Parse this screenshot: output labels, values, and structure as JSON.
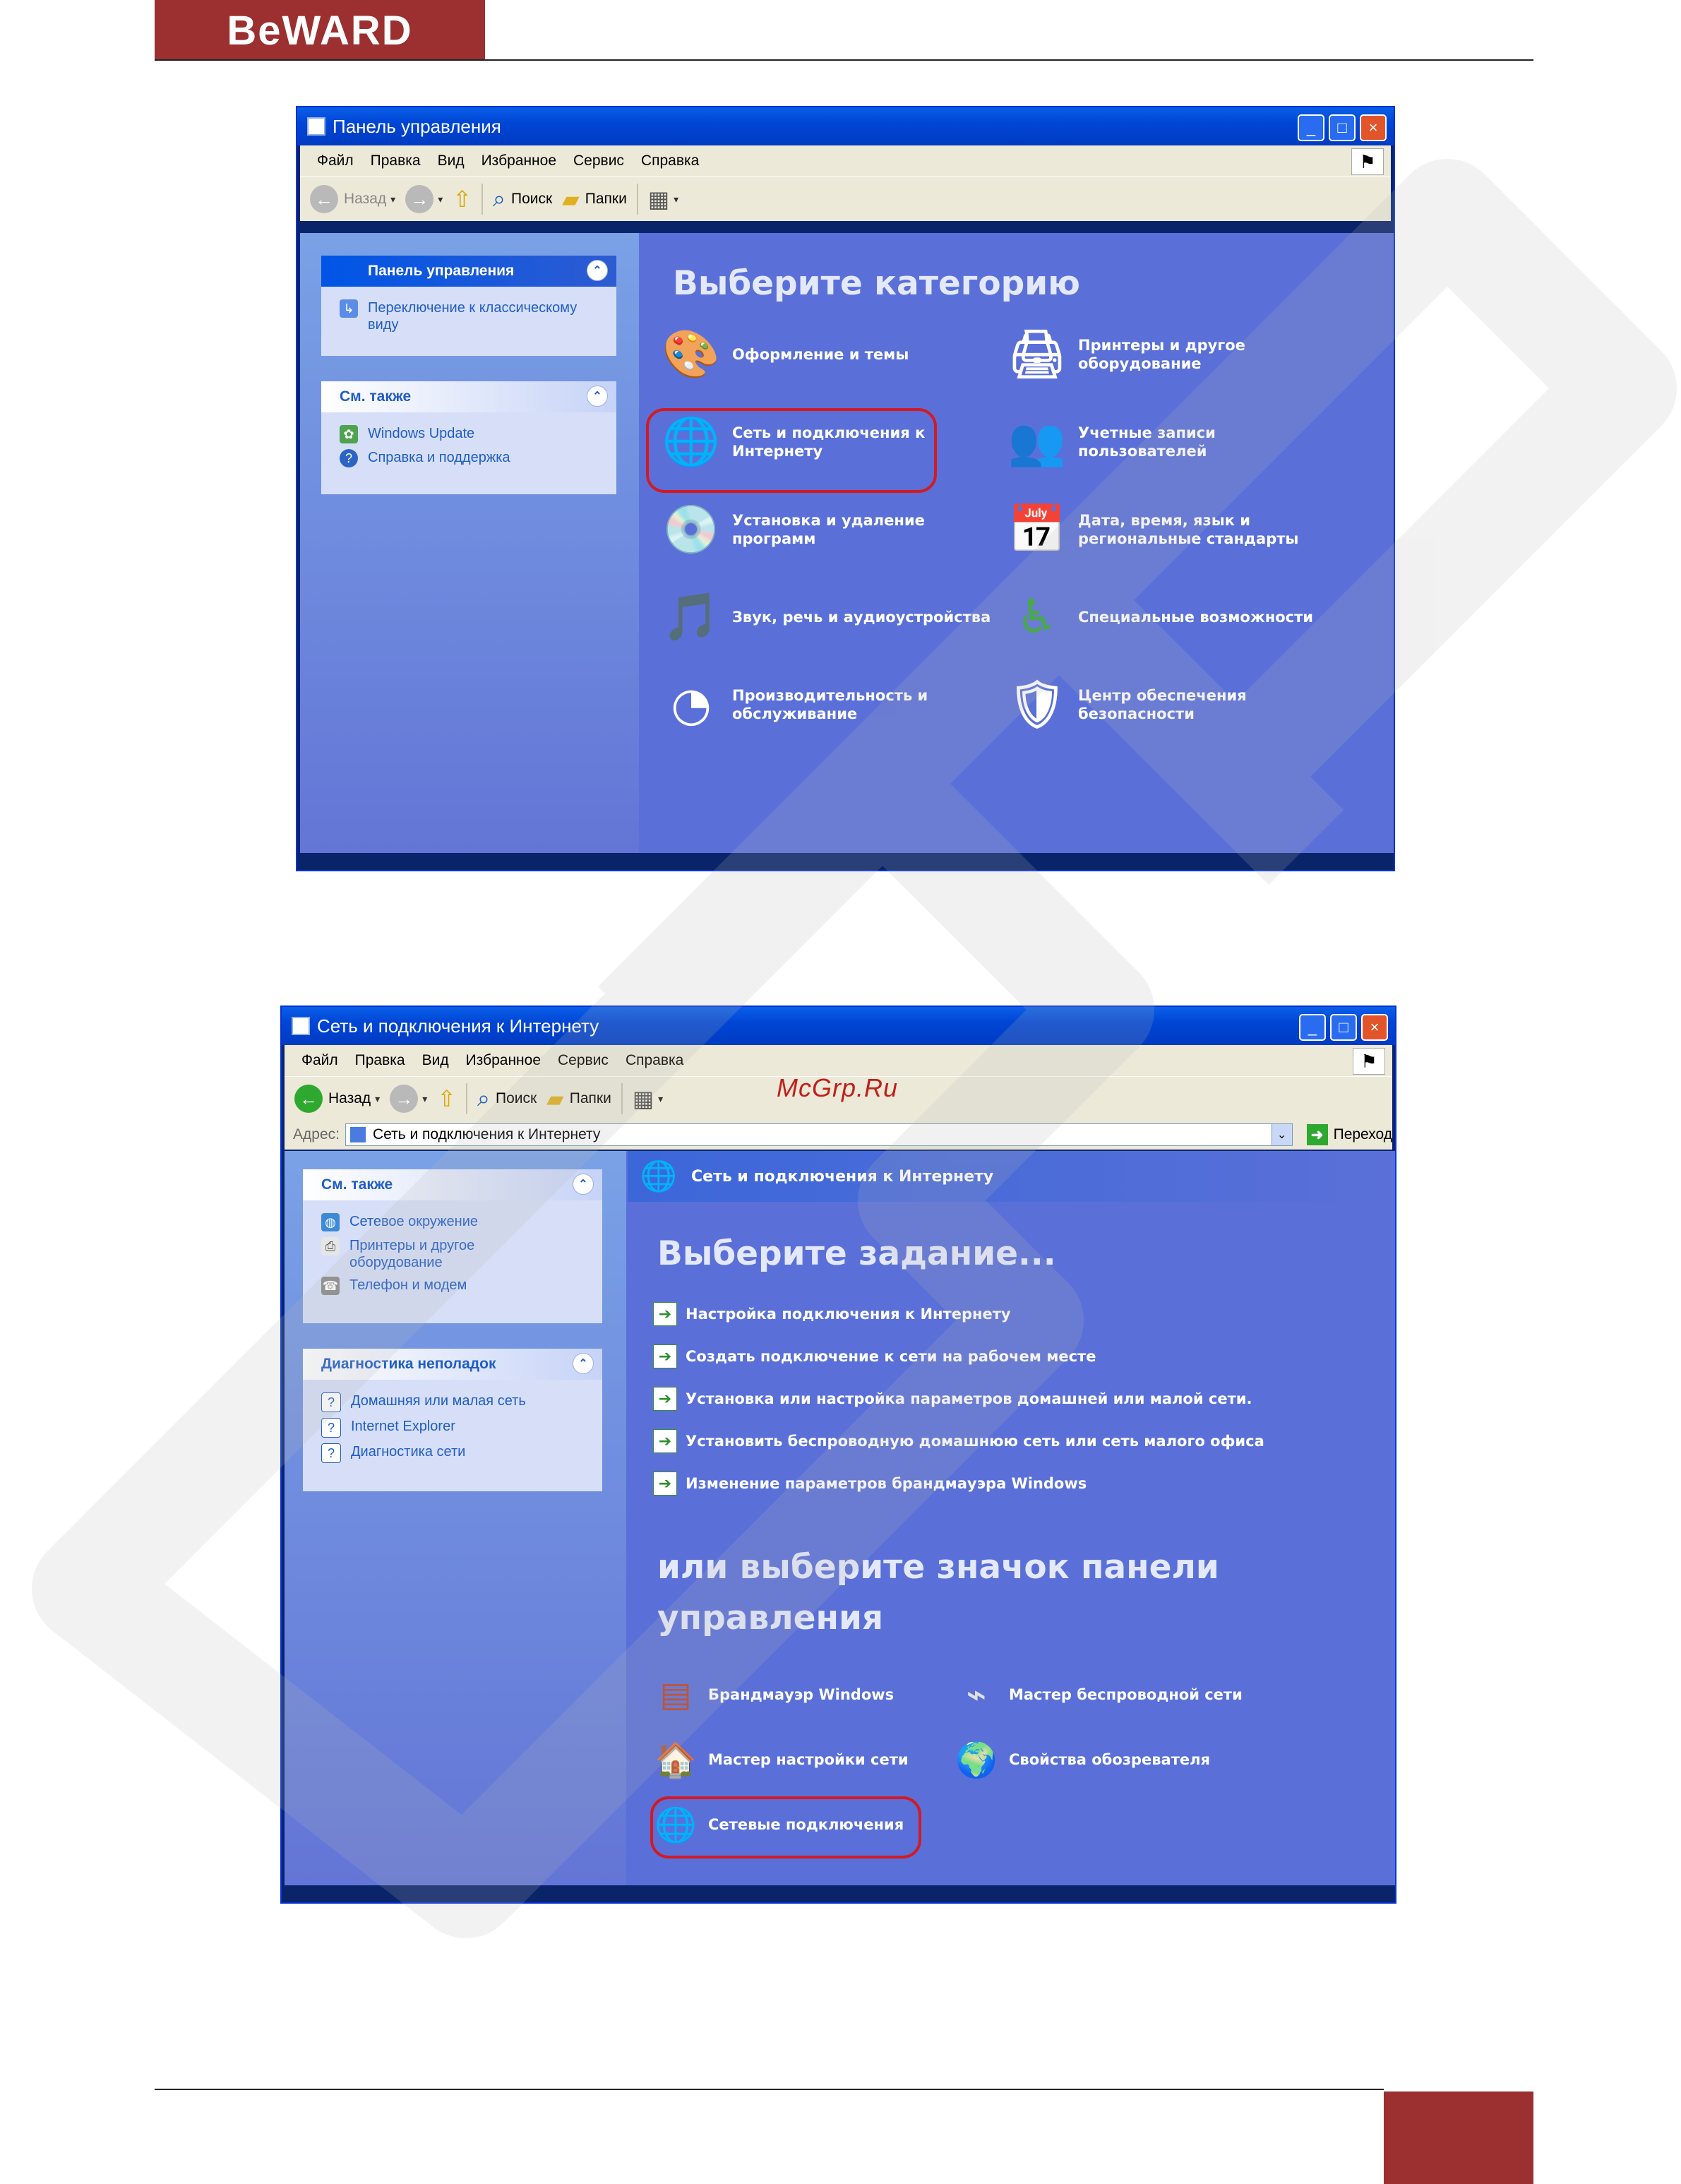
{
  "brand": {
    "logo": "BeWARD"
  },
  "overlay": {
    "site": "McGrp.Ru"
  },
  "win1": {
    "title": "Панель управления",
    "menu": [
      "Файл",
      "Правка",
      "Вид",
      "Избранное",
      "Сервис",
      "Справка"
    ],
    "toolbar": {
      "back": "Назад",
      "search": "Поиск",
      "folders": "Папки"
    },
    "panel1": {
      "title": "Панель управления",
      "link": "Переключение к классическому виду"
    },
    "panel2": {
      "title": "См. также",
      "links": [
        "Windows Update",
        "Справка и поддержка"
      ]
    },
    "heading": "Выберите категорию",
    "categories": [
      {
        "label": "Оформление и темы",
        "icon": "appearance-themes-icon"
      },
      {
        "label": "Принтеры и другое оборудование",
        "icon": "printers-hardware-icon"
      },
      {
        "label": "Сеть и подключения к Интернету",
        "icon": "network-connections-icon"
      },
      {
        "label": "Учетные записи пользователей",
        "icon": "user-accounts-icon"
      },
      {
        "label": "Установка и удаление программ",
        "icon": "add-remove-programs-icon"
      },
      {
        "label": "Дата, время, язык и региональные стандарты",
        "icon": "date-time-language-icon"
      },
      {
        "label": "Звук, речь и аудиоустройства",
        "icon": "sound-speech-icon"
      },
      {
        "label": "Специальные возможности",
        "icon": "accessibility-icon"
      },
      {
        "label": "Производительность и обслуживание",
        "icon": "performance-maintenance-icon"
      },
      {
        "label": "Центр обеспечения безопасности",
        "icon": "security-center-icon"
      }
    ]
  },
  "win2": {
    "title": "Сеть и подключения к Интернету",
    "menu": [
      "Файл",
      "Правка",
      "Вид",
      "Избранное",
      "Сервис",
      "Справка"
    ],
    "toolbar": {
      "back": "Назад",
      "search": "Поиск",
      "folders": "Папки"
    },
    "address": {
      "label": "Адрес:",
      "value": "Сеть и подключения к Интернету",
      "go": "Переход"
    },
    "panel1": {
      "title": "См. также",
      "links": [
        "Сетевое окружение",
        "Принтеры и другое оборудование",
        "Телефон и модем"
      ]
    },
    "panel2": {
      "title": "Диагностика неполадок",
      "links": [
        "Домашняя или малая сеть",
        "Internet Explorer",
        "Диагностика сети"
      ]
    },
    "crumb": "Сеть и подключения к Интернету",
    "heading1": "Выберите задание...",
    "tasks": [
      "Настройка подключения к Интернету",
      "Создать подключение к сети на рабочем месте",
      "Установка или настройка параметров домашней или малой сети.",
      "Установить беспроводную домашнюю сеть или сеть малого офиса",
      "Изменение параметров брандмауэра Windows"
    ],
    "heading2": "или выберите значок панели управления",
    "icons": [
      {
        "label": "Брандмауэр Windows",
        "icon": "firewall-icon"
      },
      {
        "label": "Мастер беспроводной сети",
        "icon": "wireless-wizard-icon"
      },
      {
        "label": "Мастер настройки сети",
        "icon": "network-setup-icon"
      },
      {
        "label": "Свойства обозревателя",
        "icon": "internet-options-icon"
      },
      {
        "label": "Сетевые подключения",
        "icon": "network-connections-icon"
      }
    ]
  },
  "colors": {
    "brand_red": "#9c2f2f",
    "xp_blue": "#0046d5",
    "highlight": "#d21a22"
  }
}
